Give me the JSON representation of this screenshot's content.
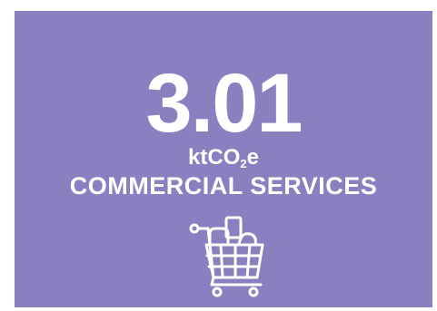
{
  "stat": {
    "value": "3.01",
    "unit_prefix": "ktCO",
    "unit_subscript": "2",
    "unit_suffix": "e",
    "category": "COMMERCIAL SERVICES"
  },
  "icon": "shopping-cart-icon",
  "colors": {
    "card_background": "#8a7fbf",
    "text": "#ffffff",
    "page_background": "#ffffff"
  }
}
